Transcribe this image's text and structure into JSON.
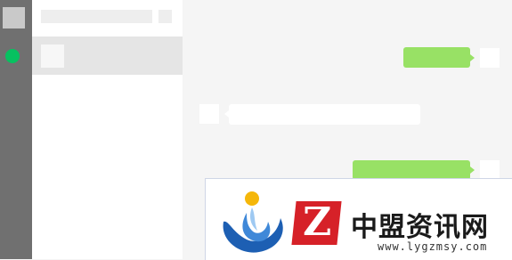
{
  "window": {
    "title": ""
  },
  "sidebar": {
    "avatar_icon": "user-avatar",
    "status_icon": "online-dot",
    "status_color": "#07c160"
  },
  "chat_list": {
    "search_placeholder": "",
    "items": [
      {
        "name": ""
      }
    ]
  },
  "conversation": {
    "messages": [
      {
        "direction": "sent",
        "text": ""
      },
      {
        "direction": "received",
        "text": ""
      },
      {
        "direction": "sent",
        "text": ""
      }
    ],
    "sent_bubble_color": "#98e165",
    "received_bubble_color": "#ffffff"
  },
  "watermark": {
    "name": "中盟资讯网",
    "url": "www.lygzmsy.com",
    "logo_letter": "Z",
    "logo_colors": {
      "blue": "#1d5fb3",
      "gold": "#f5b70a",
      "red": "#d62128"
    }
  }
}
